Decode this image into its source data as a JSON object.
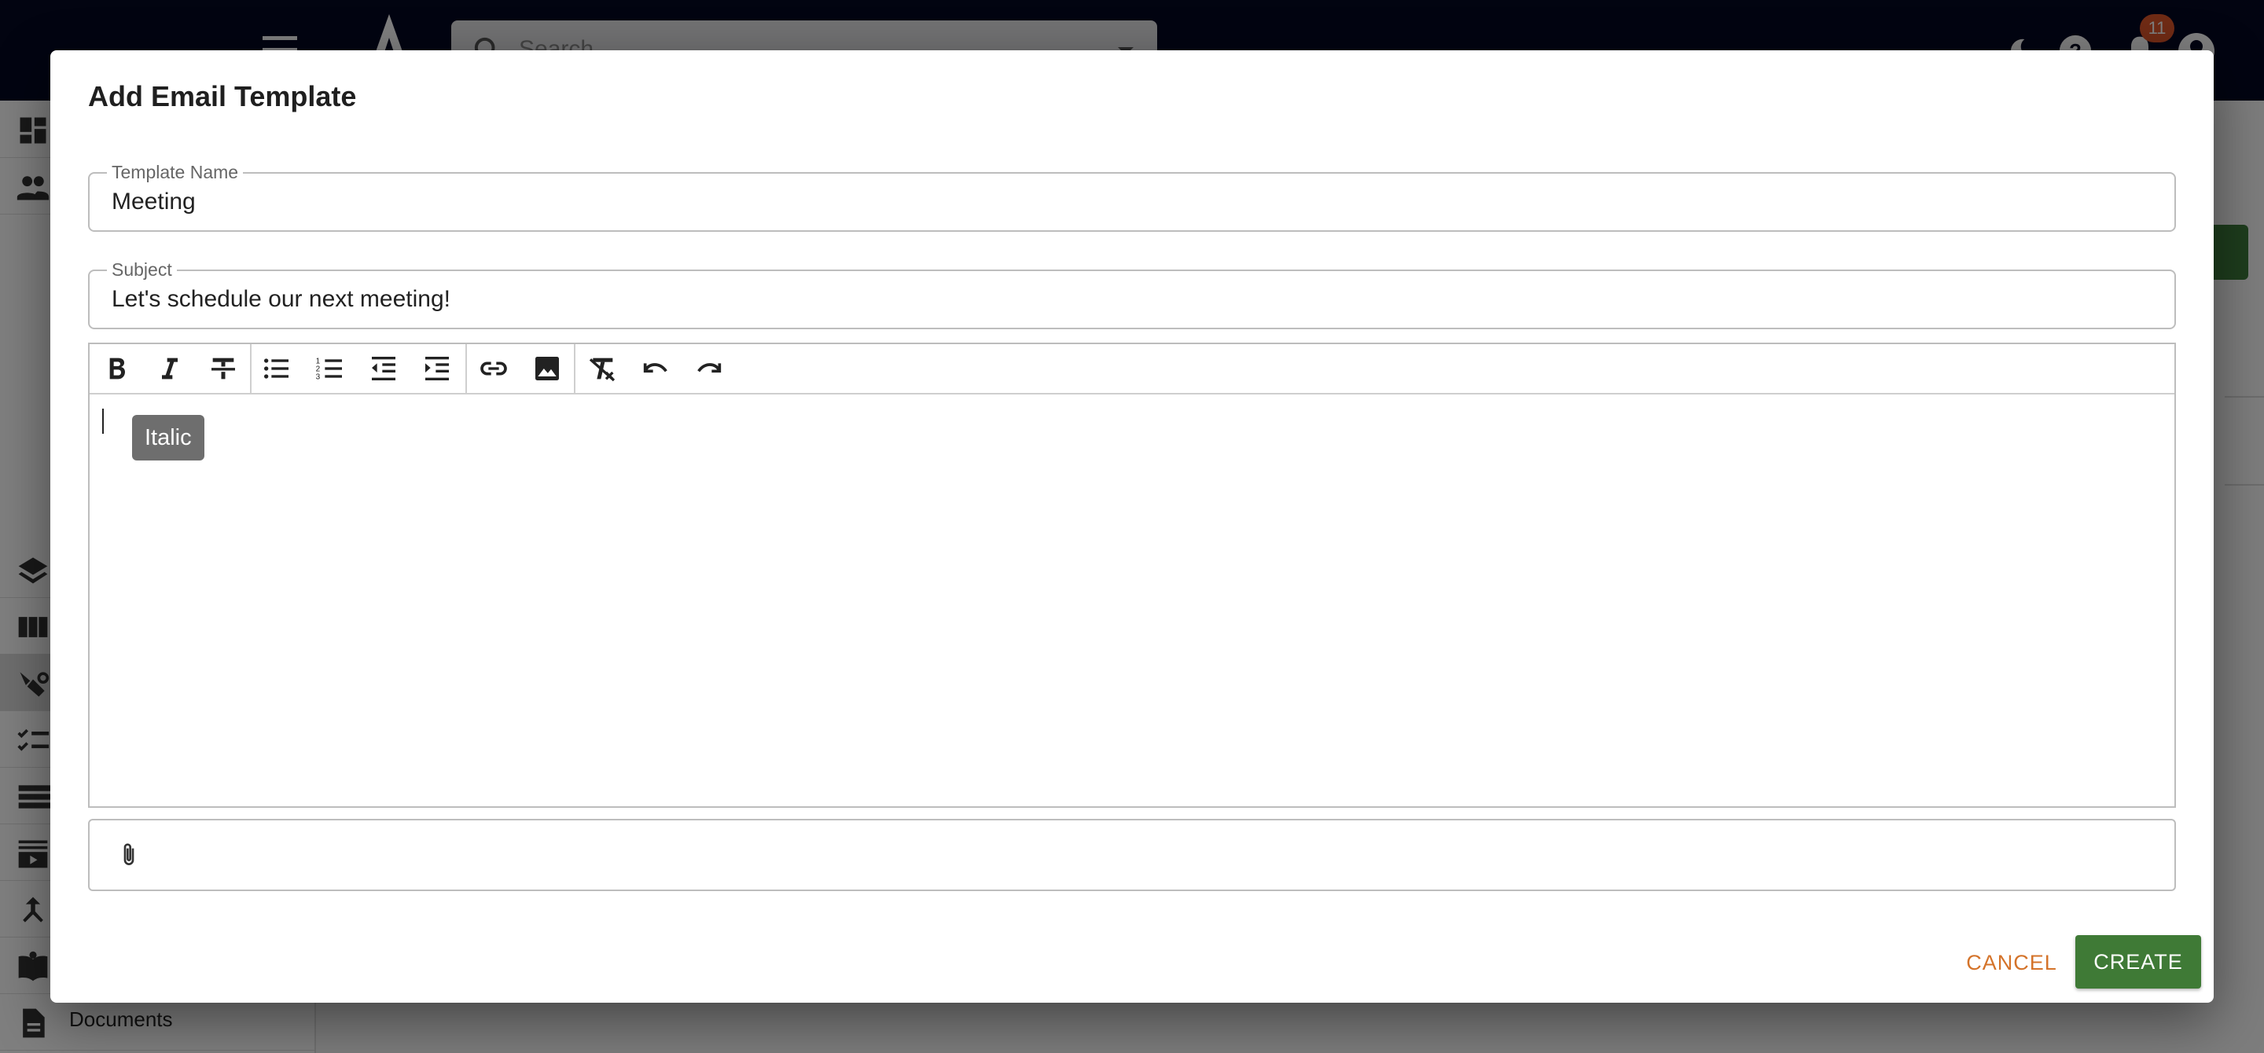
{
  "colors": {
    "appbar": "#050823",
    "primary": "#3f7a36",
    "cancel": "#d4732a",
    "badge": "#e0572a"
  },
  "app": {
    "search_placeholder": "Search",
    "notification_count": "11",
    "icons": [
      "menu-icon",
      "logo-icon",
      "search-icon",
      "dark-mode-icon",
      "help-icon",
      "notifications-icon",
      "account-icon"
    ]
  },
  "sidebar": {
    "items": [
      {
        "icon": "dashboard-icon",
        "label": ""
      },
      {
        "icon": "people-icon",
        "label": ""
      },
      {
        "icon": "layers-icon",
        "label": ""
      },
      {
        "icon": "columns-icon",
        "label": ""
      },
      {
        "icon": "campaign-icon",
        "label": ""
      },
      {
        "icon": "checklist-icon",
        "label": ""
      },
      {
        "icon": "list-icon",
        "label": ""
      },
      {
        "icon": "video-library-icon",
        "label": ""
      },
      {
        "icon": "merge-icon",
        "label": ""
      },
      {
        "icon": "book-icon",
        "label": ""
      },
      {
        "icon": "document-icon",
        "label": "Documents"
      }
    ]
  },
  "dialog": {
    "title": "Add Email Template",
    "template_name": {
      "label": "Template Name",
      "value": "Meeting"
    },
    "subject": {
      "label": "Subject",
      "value": "Let's schedule our next meeting!"
    },
    "toolbar": {
      "buttons": [
        "bold",
        "italic",
        "strikethrough",
        "bulleted-list",
        "numbered-list",
        "outdent",
        "indent",
        "link",
        "image",
        "clear-formatting",
        "undo",
        "redo"
      ]
    },
    "tooltip": "Italic",
    "editor_content": "",
    "attachment_icon": "paperclip-icon",
    "cancel_label": "CANCEL",
    "create_label": "CREATE"
  }
}
